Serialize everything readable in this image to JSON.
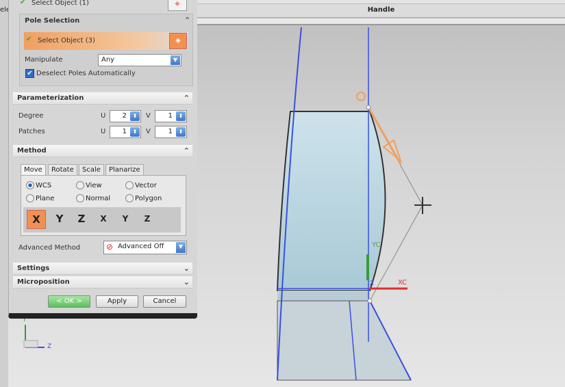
{
  "window": {
    "title": "Handle",
    "left_truncated": "ele"
  },
  "dialog": {
    "select_object_top": "Select Object (1)",
    "pole_selection": {
      "title": "Pole Selection",
      "select_object": "Select Object (3)",
      "manipulate_label": "Manipulate",
      "manipulate_value": "Any",
      "deselect_label": "Deselect Poles Automatically",
      "deselect_checked": true
    },
    "parameterization": {
      "title": "Parameterization",
      "degree_label": "Degree",
      "patches_label": "Patches",
      "u": "U",
      "v": "V",
      "degree_u": "2",
      "degree_v": "1",
      "patches_u": "1",
      "patches_v": "1"
    },
    "method": {
      "title": "Method",
      "tabs": [
        "Move",
        "Rotate",
        "Scale",
        "Planarize"
      ],
      "active_tab": "Move",
      "radios": [
        "WCS",
        "View",
        "Vector",
        "Plane",
        "Normal",
        "Polygon"
      ],
      "selected_radio": "WCS",
      "axis_icons": [
        "X",
        "Y",
        "Z",
        "X",
        "Y",
        "Z"
      ],
      "advanced_label": "Advanced Method",
      "advanced_value": "Advanced Off"
    },
    "settings": "Settings",
    "microposition": "Microposition",
    "buttons": {
      "ok": "< OK >",
      "apply": "Apply",
      "cancel": "Cancel"
    }
  },
  "viewport": {
    "yc": "YC",
    "xc": "XC",
    "zc": "Z",
    "triad_y": "Y",
    "triad_z": "Z"
  },
  "colors": {
    "accent_orange": "#f0a060",
    "curve_blue": "#3a4fe0",
    "ok_green": "#6cc76c"
  }
}
